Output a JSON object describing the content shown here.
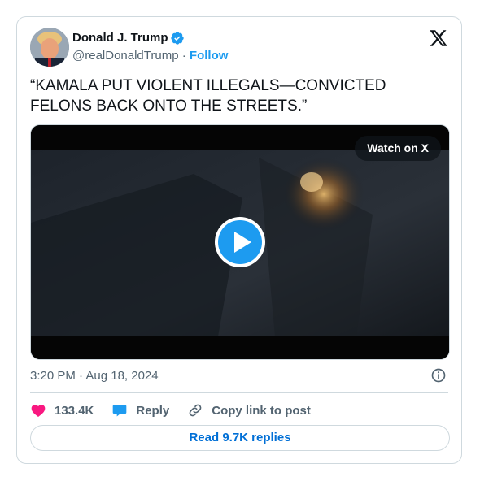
{
  "author": {
    "name": "Donald J. Trump",
    "handle": "@realDonaldTrump",
    "separator": "·",
    "follow_label": "Follow"
  },
  "icons": {
    "verified": "verified-badge-icon",
    "platform_logo": "x-logo-icon",
    "play": "play-icon",
    "info": "info-icon",
    "like": "heart-icon",
    "reply": "reply-bubble-icon",
    "copy_link": "link-icon"
  },
  "tweet": {
    "text": "“KAMALA PUT VIOLENT ILLEGALS—CONVICTED FELONS BACK ONTO THE STREETS.”"
  },
  "media": {
    "watch_label": "Watch on X"
  },
  "meta": {
    "timestamp": "3:20 PM · Aug 18, 2024"
  },
  "actions": {
    "likes": "133.4K",
    "reply_label": "Reply",
    "copy_label": "Copy link to post"
  },
  "footer": {
    "read_replies_label": "Read 9.7K replies"
  },
  "colors": {
    "accent": "#1d9bf0",
    "link": "#006fd6",
    "like": "#f91880",
    "text": "#0f1419",
    "muted": "#536471",
    "border": "#cfd9de"
  }
}
